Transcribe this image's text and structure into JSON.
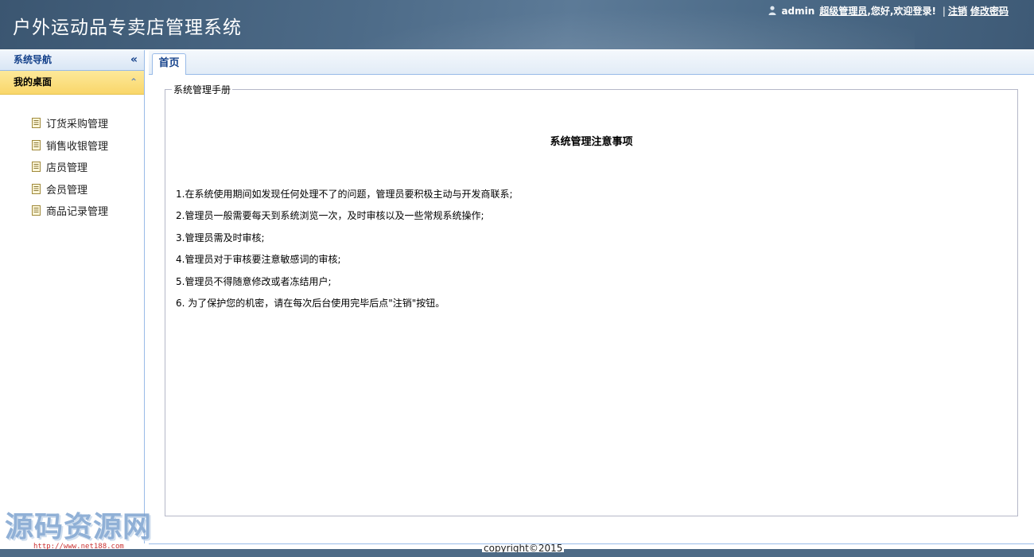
{
  "header": {
    "app_title": "户外运动品专卖店管理系统",
    "username": "admin",
    "role": "超级管理员",
    "greeting": ",您好,欢迎登录!",
    "separator": "|",
    "logout_label": "注销",
    "change_password_label": "修改密码"
  },
  "sidebar": {
    "nav_title": "系统导航",
    "nav_collapse_glyph": "«",
    "desk_title": "我的桌面",
    "desk_toggle_glyph": "⌃",
    "items": [
      {
        "label": "订货采购管理"
      },
      {
        "label": "销售收银管理"
      },
      {
        "label": "店员管理"
      },
      {
        "label": "会员管理"
      },
      {
        "label": "商品记录管理"
      }
    ]
  },
  "tabs": [
    {
      "label": "首页",
      "active": true
    }
  ],
  "manual": {
    "legend": "系统管理手册",
    "title": "系统管理注意事项",
    "rules": [
      "1.在系统使用期间如发现任何处理不了的问题，管理员要积极主动与开发商联系;",
      "2.管理员一般需要每天到系统浏览一次，及时审核以及一些常规系统操作;",
      "3.管理员需及时审核;",
      "4.管理员对于审核要注意敏感词的审核;",
      "5.管理员不得随意修改或者冻结用户;",
      "6. 为了保护您的机密，请在每次后台使用完毕后点\"注销\"按钮。"
    ]
  },
  "footer": {
    "copyright": "copyright©2015"
  },
  "watermark": {
    "text": "源码资源网",
    "url": "http://www.net188.com"
  },
  "colors": {
    "header_bg": "#4d6b88",
    "desk_header_bg": "#f9d66a",
    "nav_title_color": "#15428b",
    "border": "#99bbe8"
  }
}
